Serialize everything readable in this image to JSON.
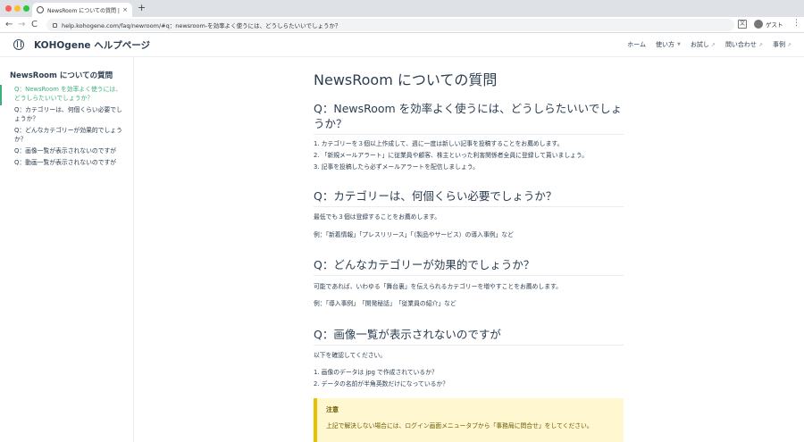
{
  "browser": {
    "tab_title": "NewsRoom についての質問 | KOHOgene ヘルプページ",
    "tab_close": "×",
    "new_tab": "+",
    "url": "help.kohogene.com/faq/newroom/#q：newsroom-を効率よく使うには、どうしらたいいでしょうか？",
    "profile_label": "ゲスト",
    "back": "←",
    "forward": "→",
    "reload": "C",
    "kebab": "⋮"
  },
  "navbar": {
    "site_title": "KOHOgene ヘルプページ",
    "links": [
      "ホーム",
      "使い方",
      "お試し",
      "問い合わせ",
      "事例"
    ]
  },
  "sidebar": {
    "heading": "NewsRoom についての質問",
    "items": [
      "Q：NewsRoom を効率よく使うには、どうしらたいいでしょうか？",
      "Q：カテゴリーは、何個くらい必要でしょうか？",
      "Q：どんなカテゴリーが効果的でしょうか？",
      "Q：画像一覧が表示されないのですが",
      "Q：動画一覧が表示されないのですが"
    ]
  },
  "main": {
    "title": "NewsRoom についての質問",
    "q1": {
      "heading": "Q：NewsRoom を効率よく使うには、どうしらたいいでしょうか？",
      "lines": [
        "1. カテゴリーを３個以上作成して、週に一度は新しい記事を投稿することをお薦めします。",
        "2. 「新規メールアラート」に従業員や顧客、株主といった利害関係者全員に登録して貰いましょう。",
        "3. 記事を投稿したら必ずメールアラートを配信しましょう。"
      ]
    },
    "q2": {
      "heading": "Q：カテゴリーは、何個くらい必要でしょうか？",
      "p1": "最低でも３個は登録することをお薦めします。",
      "p2": "例：「新着情報」「プレスリリース」「（製品やサービス）の導入事例」など"
    },
    "q3": {
      "heading": "Q：どんなカテゴリーが効果的でしょうか？",
      "p1": "可能であれば、いわゆる「舞台裏」を伝えられるカテゴリーを増やすことをお薦めします。",
      "p2": "例：「導入事例」　「開発秘話」　「従業員の紹介」など"
    },
    "q4": {
      "heading": "Q：画像一覧が表示されないのですが",
      "p1": "以下を確認してください。",
      "lines": [
        "1. 画像のデータは jpg で作成されているか？",
        "2. データの名前が半角英数だけになっているか？"
      ]
    },
    "tip": {
      "title": "注意",
      "body": "上記で解決しない場合には、ログイン画面メニュータブから「事務局に問合せ」をしてください。"
    }
  },
  "colors": {
    "accent": "#3eaf7c",
    "text": "#2c3e50",
    "tip_bg": "#fff7d0",
    "tip_border": "#e7c000"
  }
}
